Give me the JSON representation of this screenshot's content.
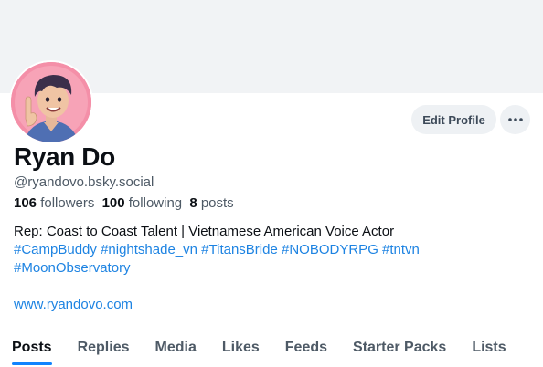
{
  "profile": {
    "display_name": "Ryan Do",
    "handle": "@ryandovo.bsky.social",
    "stats": {
      "followers_count": "106",
      "followers_label": "followers",
      "following_count": "100",
      "following_label": "following",
      "posts_count": "8",
      "posts_label": "posts"
    },
    "bio": {
      "line1": "Rep: Coast to Coast Talent | Vietnamese American Voice Actor",
      "hashtags_line1": [
        "#CampBuddy",
        "#nightshade_vn",
        "#TitansBride",
        "#NOBODYRPG",
        "#tntvn"
      ],
      "hashtags_line2": [
        "#MoonObservatory"
      ],
      "website": "www.ryandovo.com"
    }
  },
  "actions": {
    "edit_profile_label": "Edit Profile",
    "more_icon": "ellipsis-icon"
  },
  "tabs": [
    {
      "label": "Posts",
      "active": true
    },
    {
      "label": "Replies",
      "active": false
    },
    {
      "label": "Media",
      "active": false
    },
    {
      "label": "Likes",
      "active": false
    },
    {
      "label": "Feeds",
      "active": false
    },
    {
      "label": "Starter Packs",
      "active": false
    },
    {
      "label": "Lists",
      "active": false
    }
  ],
  "colors": {
    "link": "#1d83e2",
    "tab_indicator": "#1083fe",
    "banner": "#f1f3f5",
    "avatar_bg": "#f48fa8"
  }
}
